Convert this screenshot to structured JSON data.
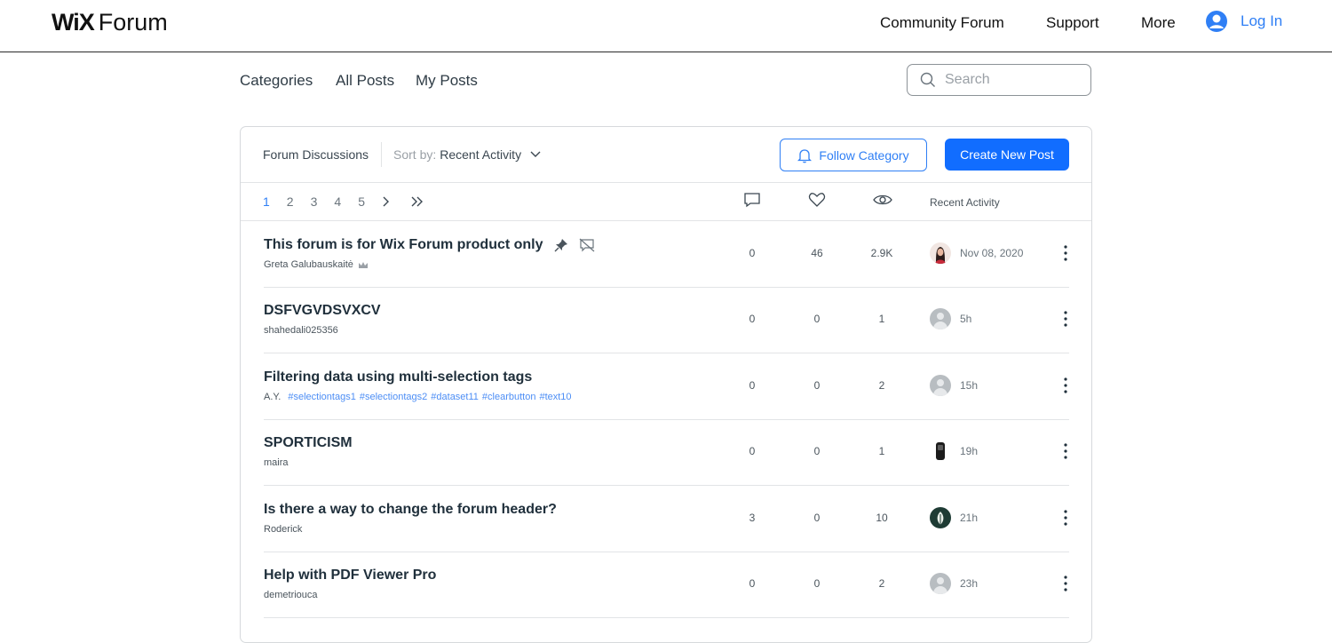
{
  "header": {
    "logo_wix": "WiX",
    "logo_forum": "Forum",
    "nav": [
      "Community Forum",
      "Support",
      "More"
    ],
    "login_label": "Log In"
  },
  "subnav": {
    "links": [
      "Categories",
      "All Posts",
      "My Posts"
    ],
    "search_placeholder": "Search"
  },
  "card": {
    "title": "Forum Discussions",
    "sort_prefix": "Sort by:",
    "sort_value": "Recent Activity",
    "follow_label": "Follow Category",
    "create_label": "Create New Post",
    "pages": [
      "1",
      "2",
      "3",
      "4",
      "5"
    ],
    "active_page": "1",
    "recent_activity_label": "Recent Activity"
  },
  "posts": [
    {
      "title": "This forum is for Wix Forum product only",
      "author": "Greta Galubauskaitė",
      "tags": [],
      "comments": "0",
      "likes": "46",
      "views": "2.9K",
      "activity": "Nov 08, 2020",
      "avatar": "woman-photo",
      "pinned": true,
      "admin": true
    },
    {
      "title": "DSFVGVDSVXCV",
      "author": "shahedali025356",
      "tags": [],
      "comments": "0",
      "likes": "0",
      "views": "1",
      "activity": "5h",
      "avatar": "generic"
    },
    {
      "title": "Filtering data using multi-selection tags",
      "author": "A.Y.",
      "tags": [
        "#selectiontags1",
        "#selectiontags2",
        "#dataset11",
        "#clearbutton",
        "#text10"
      ],
      "comments": "0",
      "likes": "0",
      "views": "2",
      "activity": "15h",
      "avatar": "generic"
    },
    {
      "title": "SPORTICISM",
      "author": "maira",
      "tags": [],
      "comments": "0",
      "likes": "0",
      "views": "1",
      "activity": "19h",
      "avatar": "dark-photo"
    },
    {
      "title": "Is there a way to change the forum header?",
      "author": "Roderick",
      "tags": [],
      "comments": "3",
      "likes": "0",
      "views": "10",
      "activity": "21h",
      "avatar": "plant-photo"
    },
    {
      "title": "Help with PDF Viewer Pro",
      "author": "demetriouca",
      "tags": [],
      "comments": "0",
      "likes": "0",
      "views": "2",
      "activity": "23h",
      "avatar": "generic"
    }
  ],
  "colors": {
    "accent": "#116dff",
    "link": "#2f7ff5",
    "text": "#20303c"
  }
}
